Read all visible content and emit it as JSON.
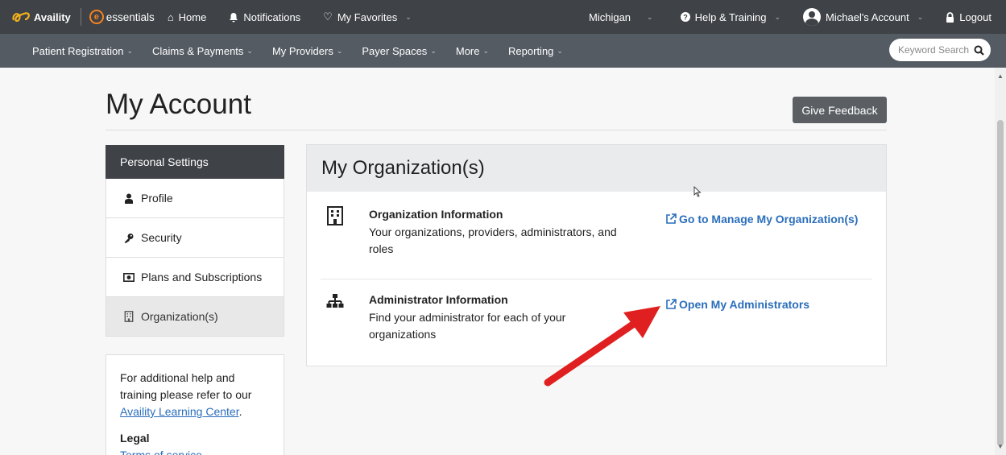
{
  "topbar": {
    "brand": "Availity",
    "product": "essentials",
    "home": "Home",
    "notifications": "Notifications",
    "favorites": "My Favorites",
    "region": "Michigan",
    "help": "Help & Training",
    "account": "Michael's Account",
    "logout": "Logout"
  },
  "subnav": {
    "items": [
      {
        "label": "Patient Registration"
      },
      {
        "label": "Claims & Payments"
      },
      {
        "label": "My Providers"
      },
      {
        "label": "Payer Spaces"
      },
      {
        "label": "More"
      },
      {
        "label": "Reporting"
      }
    ],
    "search_placeholder": "Keyword Search"
  },
  "page": {
    "title": "My Account",
    "feedback": "Give Feedback"
  },
  "menu": {
    "header": "Personal Settings",
    "items": [
      {
        "label": "Profile"
      },
      {
        "label": "Security"
      },
      {
        "label": "Plans and Subscriptions"
      },
      {
        "label": "Organization(s)"
      }
    ]
  },
  "help": {
    "text": "For additional help and training please refer to our",
    "link": "Availity Learning Center",
    "legal_heading": "Legal",
    "terms": "Terms of service"
  },
  "org": {
    "header": "My Organization(s)",
    "rows": [
      {
        "title": "Organization Information",
        "desc": "Your organizations, providers, administrators, and roles",
        "link": "Go to Manage My Organization(s)"
      },
      {
        "title": "Administrator Information",
        "desc": "Find your administrator for each of your organizations",
        "link": "Open My Administrators"
      }
    ]
  },
  "colors": {
    "topbar": "#3f4246",
    "subnav": "#545b63",
    "link": "#2a6ebb",
    "brand_orange": "#f58220",
    "annotation_arrow": "#e02020"
  }
}
